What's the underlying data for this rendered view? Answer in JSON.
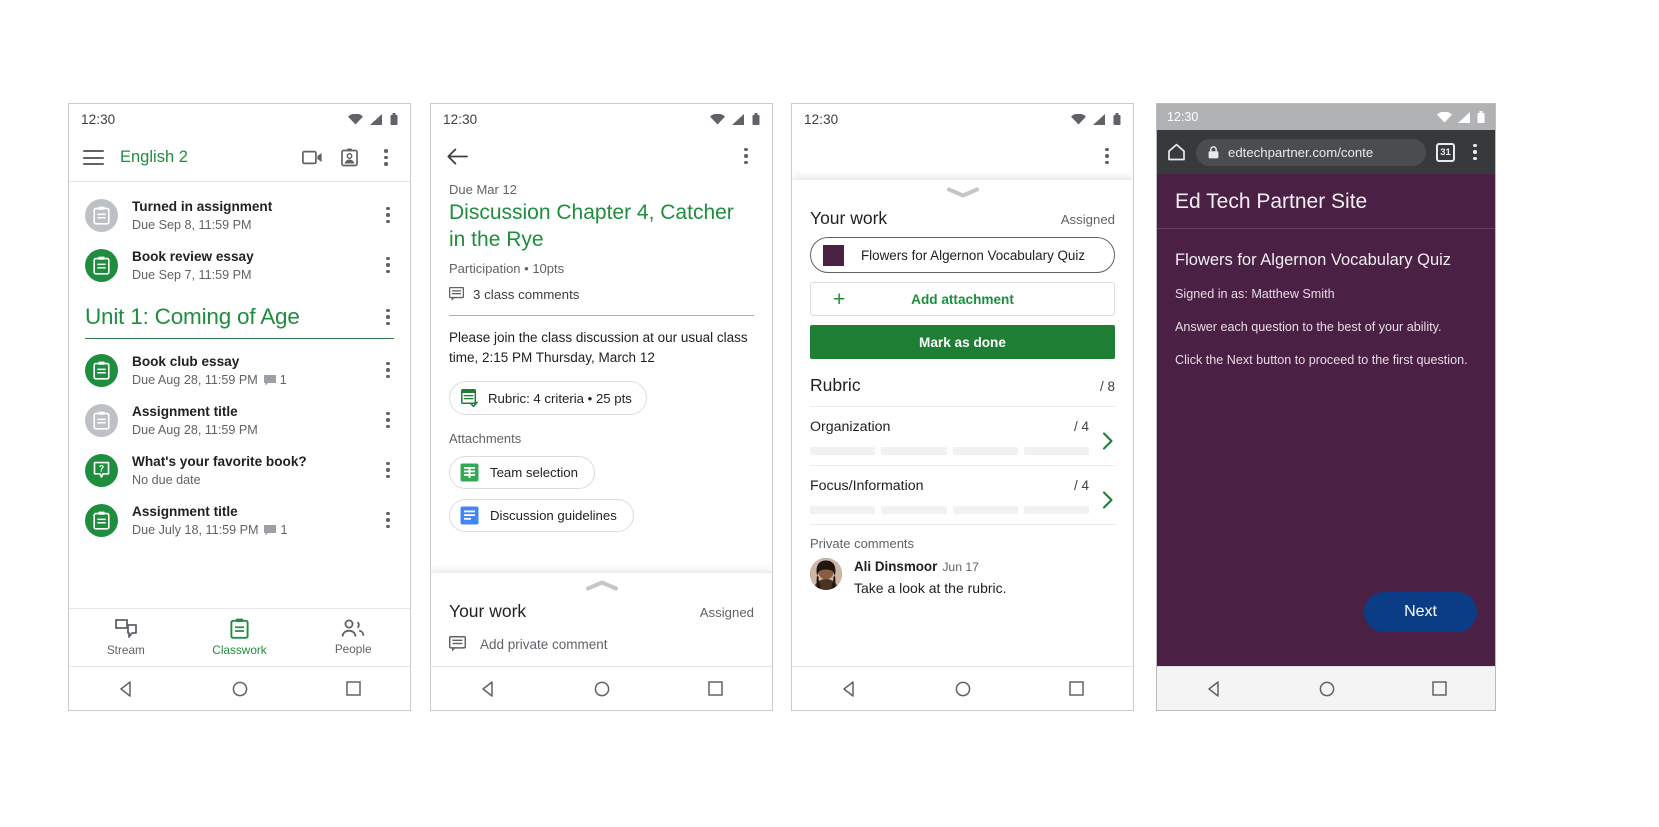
{
  "phone1": {
    "status": {
      "clock": "12:30"
    },
    "appbar": {
      "title": "English 2",
      "menu_icon": "hamburger-icon",
      "video_icon": "video-camera-icon",
      "roster_icon": "class-card-icon",
      "overflow_icon": "kebab-menu-icon"
    },
    "top_items": [
      {
        "title": "Turned in assignment",
        "subtitle": "Due Sep 8, 11:59 PM",
        "icon": "assignment-icon",
        "state": "grey",
        "comments": ""
      },
      {
        "title": "Book review essay",
        "subtitle": "Due Sep 7, 11:59 PM",
        "icon": "assignment-icon",
        "state": "green",
        "comments": ""
      }
    ],
    "unit": {
      "title": "Unit 1: Coming of Age"
    },
    "unit_items": [
      {
        "title": "Book club essay",
        "subtitle": "Due Aug 28, 11:59 PM",
        "icon": "assignment-icon",
        "state": "green",
        "comments": "1"
      },
      {
        "title": "Assignment title",
        "subtitle": "Due Aug 28, 11:59 PM",
        "icon": "assignment-icon",
        "state": "grey",
        "comments": ""
      },
      {
        "title": "What's your favorite book?",
        "subtitle": "No due date",
        "icon": "question-icon",
        "state": "green",
        "comments": ""
      },
      {
        "title": "Assignment title",
        "subtitle": "Due July 18, 11:59 PM",
        "icon": "assignment-icon",
        "state": "green",
        "comments": "1"
      }
    ],
    "bottom_nav": [
      {
        "label": "Stream",
        "icon": "stream-icon",
        "active": false
      },
      {
        "label": "Classwork",
        "icon": "classwork-icon",
        "active": true
      },
      {
        "label": "People",
        "icon": "people-icon",
        "active": false
      }
    ]
  },
  "phone2": {
    "status": {
      "clock": "12:30"
    },
    "appbar": {
      "back_icon": "back-arrow-icon",
      "overflow_icon": "kebab-menu-icon"
    },
    "due": "Due Mar 12",
    "title": "Discussion Chapter 4, Catcher in the Rye",
    "meta": "Participation • 10pts",
    "class_comments": "3 class comments",
    "description": "Please join the class discussion at our usual class time, 2:15 PM Thursday, March 12",
    "rubric_chip": "Rubric: 4 criteria • 25 pts",
    "attachments_label": "Attachments",
    "attachments": [
      {
        "label": "Team selection",
        "icon": "google-sheets-icon"
      },
      {
        "label": "Discussion guidelines",
        "icon": "google-docs-icon"
      }
    ],
    "sheet": {
      "heading": "Your work",
      "status": "Assigned",
      "private_comment": "Add private comment",
      "comment_icon": "comment-icon"
    }
  },
  "phone3": {
    "status": {
      "clock": "12:30"
    },
    "appbar": {
      "overflow_icon": "kebab-menu-icon"
    },
    "sheet": {
      "heading": "Your work",
      "status": "Assigned"
    },
    "work_chip": {
      "label": "Flowers for Algernon Vocabulary Quiz",
      "thumb_color": "#4a2044"
    },
    "add_attachment": "Add attachment",
    "mark_as_done": "Mark as done",
    "rubric": {
      "heading": "Rubric",
      "total": "/ 8",
      "criteria": [
        {
          "name": "Organization",
          "points": "/ 4",
          "levels": 4
        },
        {
          "name": "Focus/Information",
          "points": "/ 4",
          "levels": 4
        }
      ]
    },
    "private_comments": {
      "heading": "Private comments",
      "items": [
        {
          "author": "Ali Dinsmoor",
          "date": "Jun 17",
          "text": "Take a look at the rubric."
        }
      ]
    }
  },
  "phone4": {
    "status": {
      "clock": "12:30"
    },
    "browser": {
      "home_icon": "home-icon",
      "lock_icon": "lock-icon",
      "url": "edtechpartner.com/conte",
      "tab_count": "31",
      "overflow_icon": "kebab-menu-icon"
    },
    "page": {
      "site_title": "Ed Tech Partner Site",
      "quiz_title": "Flowers for Algernon Vocabulary Quiz",
      "lines": [
        "Signed in as: Matthew Smith",
        "Answer each question to the best of your ability.",
        "Click the Next button to proceed to the first question."
      ],
      "next_button": "Next",
      "bg_color": "#4a2044",
      "button_color": "#0b3d87"
    }
  },
  "nav": {
    "back_icon": "android-back-icon",
    "home_icon": "android-home-icon",
    "recents_icon": "android-recents-icon"
  }
}
